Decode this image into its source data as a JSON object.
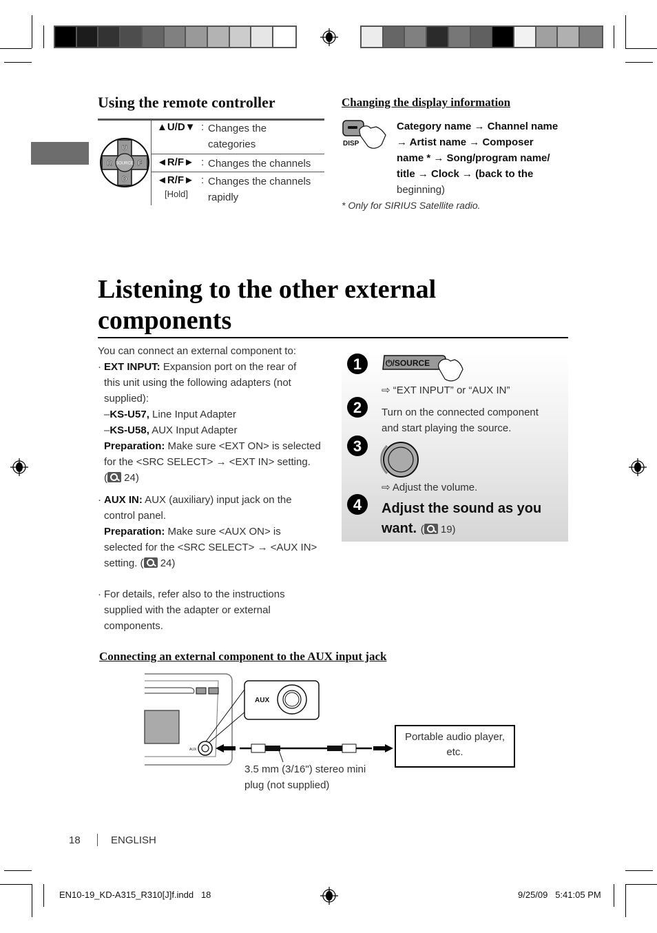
{
  "color_bars": {
    "left": [
      "#000000",
      "#1c1c1c",
      "#333333",
      "#4d4d4d",
      "#666666",
      "#808080",
      "#999999",
      "#b3b3b3",
      "#cccccc",
      "#e6e6e6",
      "#ffffff"
    ],
    "right": [
      "#ececec",
      "#666666",
      "#808080",
      "#2b2b2b",
      "#777777",
      "#606060",
      "#000000",
      "#f2f2f2",
      "#a0a0a0",
      "#b0b0b0",
      "#808080"
    ]
  },
  "remote": {
    "title": "Using the remote controller",
    "dpad_labels": {
      "up": "U",
      "down": "D",
      "left": "R",
      "right": "F",
      "center": "SOURCE"
    },
    "rows": [
      {
        "key": "▲U/D▼",
        "sub": "",
        "desc_lines": [
          "Changes the",
          "categories"
        ]
      },
      {
        "key": "◄R/F►",
        "sub": "",
        "desc_lines": [
          "Changes the channels"
        ]
      },
      {
        "key": "◄R/F►",
        "sub": "[Hold]",
        "desc_lines": [
          "Changes the channels",
          "rapidly"
        ]
      }
    ]
  },
  "display_info": {
    "title": "Changing the display information",
    "button_label": "DISP",
    "lines": [
      "Category name → Channel name",
      "→ Artist name → Composer",
      "name * → Song/program name/",
      "title → Clock → (back to the",
      "beginning)"
    ],
    "footnote": "* Only for SIRIUS Satellite radio."
  },
  "section": {
    "title_line1": "Listening to the other external",
    "title_line2": "components"
  },
  "left_col": {
    "intro": "You can connect an external component to:",
    "ext_label": "EXT INPUT:",
    "ext_text_1": " Expansion port on the rear of",
    "ext_text_2": "this unit using the following adapters (not",
    "ext_text_3": "supplied):",
    "ksu57_model": "KS-U57,",
    "ksu57_desc": " Line Input Adapter",
    "ksu58_model": "KS-U58,",
    "ksu58_desc": " AUX Input Adapter",
    "prep_label": "Preparation:",
    "ext_prep_1": " Make sure <EXT ON> is selected",
    "ext_prep_2": "for the <SRC SELECT> → <EXT IN> setting.",
    "ext_ref": "24",
    "aux_label": "AUX IN:",
    "aux_text_1": " AUX (auxiliary) input jack on the",
    "aux_text_2": "control panel.",
    "aux_prep_1": " Make sure <AUX ON> is",
    "aux_prep_2": "selected for the <SRC SELECT> → <AUX IN>",
    "aux_prep_3": "setting. (",
    "aux_ref": "24",
    "details_1": "For details, refer also to the instructions",
    "details_2": "supplied with the adapter or external",
    "details_3": "components."
  },
  "steps": {
    "s1_num": "1",
    "source_button": "⏻/SOURCE",
    "s1_result": "⇨ “EXT INPUT” or “AUX IN”",
    "s2_num": "2",
    "s2_line1": "Turn on the connected component",
    "s2_line2": "and start playing the source.",
    "s3_num": "3",
    "s3_result": "⇨ Adjust the volume.",
    "s4_num": "4",
    "s4_line1": "Adjust the sound as you",
    "s4_line2": "want.",
    "s4_ref": "19"
  },
  "connection": {
    "title": "Connecting an external component to the AUX input jack",
    "aux_callout": "AUX",
    "aux_small": "AUX",
    "plug_caption_1": "3.5 mm (3/16\") stereo mini",
    "plug_caption_2": "plug (not supplied)",
    "device_label_1": "Portable audio player,",
    "device_label_2": "etc."
  },
  "footer": {
    "page_number": "18",
    "language": "ENGLISH",
    "file_name": "EN10-19_KD-A315_R310[J]f.indd   18",
    "timestamp": "9/25/09   5:41:05 PM"
  }
}
